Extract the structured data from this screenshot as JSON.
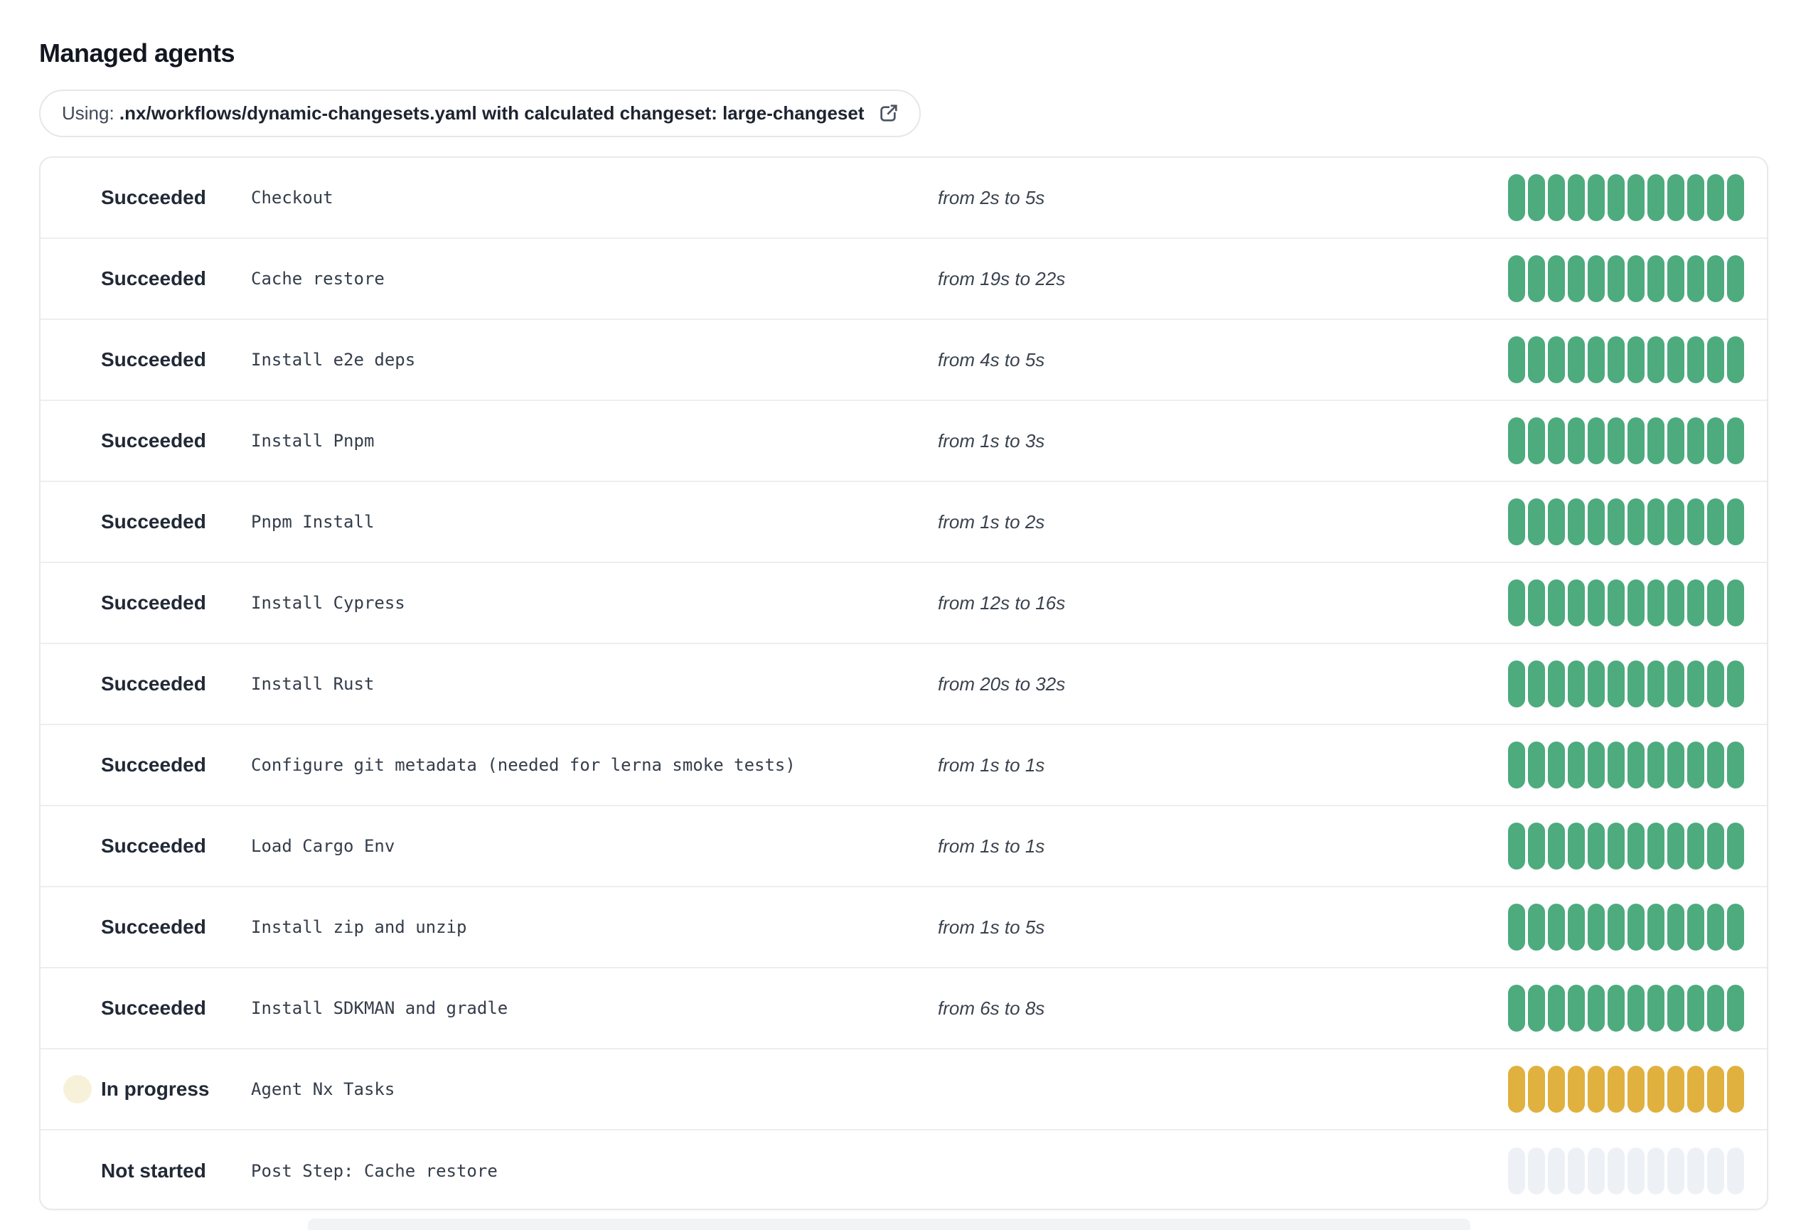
{
  "page": {
    "title": "Managed agents"
  },
  "banner": {
    "prefix": "Using: ",
    "bold_text": ".nx/workflows/dynamic-changesets.yaml with calculated changeset: large-changeset",
    "icon": "external-link-icon"
  },
  "colors": {
    "succeeded": "#4dab7e",
    "in_progress": "#e0b13f",
    "in_progress_halo": "#f8f1da",
    "not_started_dot": "#e9edf2",
    "not_started_bar": "#edf1f6"
  },
  "bars": {
    "segment_count": 12
  },
  "steps": [
    {
      "status": "succeeded",
      "status_label": "Succeeded",
      "name": "Checkout",
      "duration": "from 2s to 5s"
    },
    {
      "status": "succeeded",
      "status_label": "Succeeded",
      "name": "Cache restore",
      "duration": "from 19s to 22s"
    },
    {
      "status": "succeeded",
      "status_label": "Succeeded",
      "name": "Install e2e deps",
      "duration": "from 4s to 5s"
    },
    {
      "status": "succeeded",
      "status_label": "Succeeded",
      "name": "Install Pnpm",
      "duration": "from 1s to 3s"
    },
    {
      "status": "succeeded",
      "status_label": "Succeeded",
      "name": "Pnpm Install",
      "duration": "from 1s to 2s"
    },
    {
      "status": "succeeded",
      "status_label": "Succeeded",
      "name": "Install Cypress",
      "duration": "from 12s to 16s"
    },
    {
      "status": "succeeded",
      "status_label": "Succeeded",
      "name": "Install Rust",
      "duration": "from 20s to 32s"
    },
    {
      "status": "succeeded",
      "status_label": "Succeeded",
      "name": "Configure git metadata (needed for lerna smoke tests)",
      "duration": "from 1s to 1s"
    },
    {
      "status": "succeeded",
      "status_label": "Succeeded",
      "name": "Load Cargo Env",
      "duration": "from 1s to 1s"
    },
    {
      "status": "succeeded",
      "status_label": "Succeeded",
      "name": "Install zip and unzip",
      "duration": "from 1s to 5s"
    },
    {
      "status": "succeeded",
      "status_label": "Succeeded",
      "name": "Install SDKMAN and gradle",
      "duration": "from 6s to 8s"
    },
    {
      "status": "in_progress",
      "status_label": "In progress",
      "name": "Agent Nx Tasks",
      "duration": ""
    },
    {
      "status": "not_started",
      "status_label": "Not started",
      "name": "Post Step: Cache restore",
      "duration": ""
    }
  ]
}
